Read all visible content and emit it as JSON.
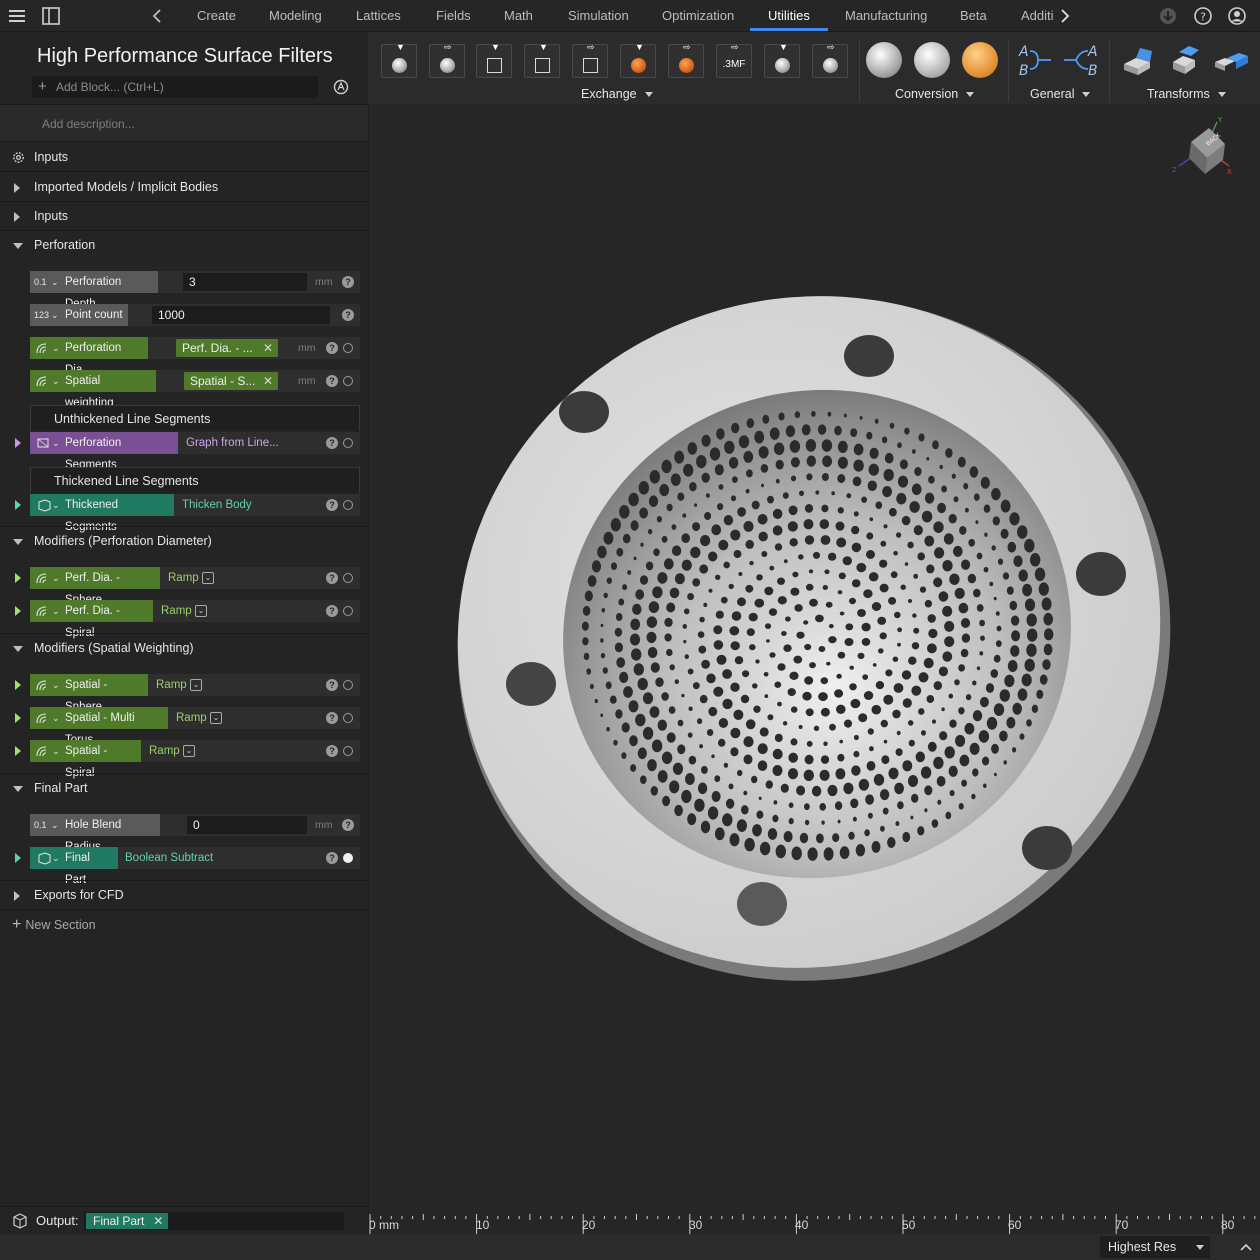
{
  "topbar": {
    "tabs": [
      "Create",
      "Modeling",
      "Lattices",
      "Fields",
      "Math",
      "Simulation",
      "Optimization",
      "Utilities",
      "Manufacturing",
      "Beta",
      "Additi"
    ],
    "active_tab": "Utilities"
  },
  "panel": {
    "title": "High Performance Surface Filters",
    "add_block_placeholder": "Add Block... (Ctrl+L)",
    "description_placeholder": "Add description...",
    "sections": {
      "inputs_top": "Inputs",
      "imported": "Imported Models / Implicit Bodies",
      "inputs": "Inputs",
      "perforation": "Perforation",
      "modifiers_dia": "Modifiers (Perforation Diameter)",
      "modifiers_spatial": "Modifiers (Spatial Weighting)",
      "final_part": "Final Part",
      "exports": "Exports for CFD"
    },
    "perforation_depth": {
      "icon": "0.1",
      "label": "Perforation Depth",
      "value": "3",
      "unit": "mm"
    },
    "point_count": {
      "icon": "123",
      "label": "Point count",
      "value": "1000"
    },
    "perforation_dia": {
      "label": "Perforation Dia.",
      "chip": "Perf. Dia. - ...",
      "unit": "mm"
    },
    "spatial_weighting": {
      "label": "Spatial weighting",
      "chip": "Spatial - S...",
      "unit": "mm"
    },
    "unthickened_header": "Unthickened Line Segments",
    "perforation_segments": {
      "label": "Perforation Segments",
      "link": "Graph from Line..."
    },
    "thickened_header": "Thickened Line Segments",
    "thickened_segments": {
      "label": "Thickened Segments",
      "link": "Thicken Body"
    },
    "mod_dia": [
      {
        "label": "Perf. Dia. - Sphere",
        "link": "Ramp"
      },
      {
        "label": "Perf. Dia. - Spiral",
        "link": "Ramp"
      }
    ],
    "mod_spatial": [
      {
        "label": "Spatial - Sphere",
        "link": "Ramp"
      },
      {
        "label": "Spatial - Multi Torus",
        "link": "Ramp"
      },
      {
        "label": "Spatial - Spiral",
        "link": "Ramp"
      }
    ],
    "hole_blend": {
      "icon": "0.1",
      "label": "Hole Blend Radius",
      "value": "0",
      "unit": "mm"
    },
    "final_part_row": {
      "label": "Final Part",
      "link": "Boolean Subtract"
    },
    "new_section": "New Section",
    "output_label": "Output:",
    "output_chip": "Final Part"
  },
  "ribbon": {
    "exchange": "Exchange",
    "conversion": "Conversion",
    "general": "General",
    "transforms": "Transforms",
    "threemf": ".3MF"
  },
  "viewcube": {
    "face": "BACK",
    "axis_x": "X",
    "axis_y": "Y",
    "axis_z": "Z"
  },
  "ruler": {
    "labels": [
      "0 mm",
      "10",
      "20",
      "30",
      "40",
      "50",
      "60",
      "70",
      "80"
    ]
  },
  "status": {
    "resolution": "Highest Res"
  }
}
